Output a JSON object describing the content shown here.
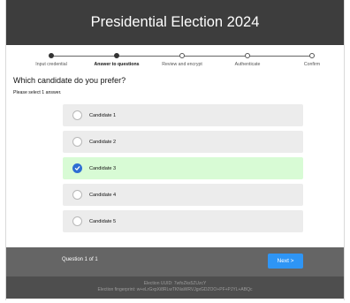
{
  "header": {
    "title": "Presidential Election 2024"
  },
  "stepper": {
    "steps": [
      {
        "label": "Input credential"
      },
      {
        "label": "Answer to questions"
      },
      {
        "label": "Review and encrypt"
      },
      {
        "label": "Authenticate"
      },
      {
        "label": "Confirm"
      }
    ],
    "current_step": 2
  },
  "question": {
    "title": "Which candidate do you prefer?",
    "hint": "Please select 1 answer.",
    "options": [
      {
        "label": "Candidate 1",
        "selected": false
      },
      {
        "label": "Candidate 2",
        "selected": false
      },
      {
        "label": "Candidate 3",
        "selected": true
      },
      {
        "label": "Candidate 4",
        "selected": false
      },
      {
        "label": "Candidate 5",
        "selected": false
      }
    ]
  },
  "footer": {
    "question_count": "Question 1 of 1",
    "next_label": "Next >"
  },
  "info": {
    "uuid_line": "Election UUID: 7wfoZks5ZUzcY",
    "fingerprint_line": "Election fingerprint: w+eLrGxpXi8RLwTKNaWRVJgxGDZOO+PF+PJYL+ABQc"
  },
  "colors": {
    "header_bg": "#3d3d3d",
    "selected_bg": "#d8fbd5",
    "radio_checked": "#2f6ed3",
    "next_button": "#2e95f5"
  }
}
